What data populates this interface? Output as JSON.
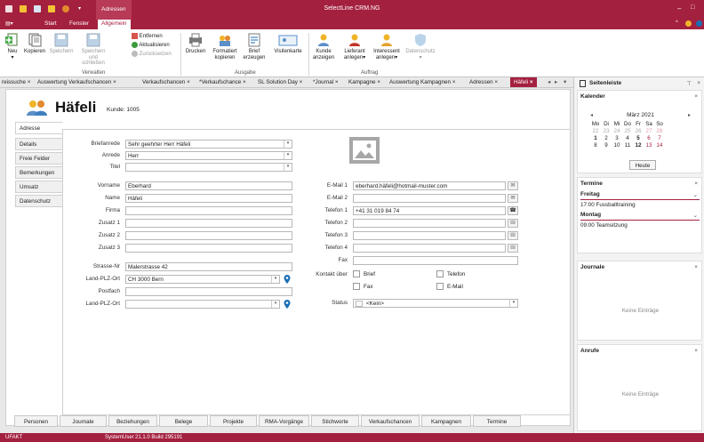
{
  "app": {
    "title": "SelectLine CRM.NG",
    "context_tab": "Adressen",
    "ribbon_tabs": [
      "Start",
      "Fenster",
      "Allgemein"
    ],
    "active_ribbon_tab": "Allgemein"
  },
  "ribbon": {
    "neu": "Neu",
    "kopieren": "Kopieren",
    "speichern": "Speichern",
    "speichern_schliessen_1": "Speichern und",
    "speichern_schliessen_2": "schließen",
    "entfernen": "Entfernen",
    "aktualisieren": "Aktualisieren",
    "zuruecksetzen": "Zurücksetzen",
    "drucken": "Drucken",
    "formatiert_1": "Formatiert",
    "formatiert_2": "kopieren",
    "brief_1": "Brief",
    "brief_2": "erzeugen",
    "visitenkarte": "Visitenkarte",
    "kunde_1": "Kunde",
    "kunde_2": "anzeigen",
    "lieferant_1": "Lieferant",
    "lieferant_2": "anlegen",
    "interessent_1": "Interessent",
    "interessent_2": "anlegen",
    "datenschutz": "Datenschutz",
    "group_verwalten": "Verwalten",
    "group_ausgabe": "Ausgabe",
    "group_auftrag": "Auftrag"
  },
  "doc_tabs": [
    "reissuche",
    "Auswertung Verkaufschancen",
    "Verkaufschancen",
    "*Verkaufschance",
    "SL Solution Day",
    "*Journal",
    "Kampagne",
    "Auswertung Kampagnen",
    "Adressen",
    "Häfeli"
  ],
  "header": {
    "name": "Häfeli",
    "kunde_label": "Kunde: 1005"
  },
  "side_tabs": [
    "Adresse",
    "Details",
    "Freie Felder",
    "Bemerkungen",
    "Umsatz",
    "Datenschutz"
  ],
  "form": {
    "briefanrede_label": "Briefanrede",
    "briefanrede": "Sehr geehrter Herr Häfeli",
    "anrede_label": "Anrede",
    "anrede": "Herr",
    "titel_label": "Titel",
    "titel": "",
    "vorname_label": "Vorname",
    "vorname": "Eberhard",
    "name_label": "Name",
    "name": "Häfeli",
    "firma_label": "Firma",
    "firma": "",
    "zusatz1_label": "Zusatz 1",
    "zusatz2_label": "Zusatz 2",
    "zusatz3_label": "Zusatz 3",
    "strasse_label": "Strasse-Nr",
    "strasse": "Malerstrasse 42",
    "landplz_label": "Land-PLZ-Ort",
    "landplz": "CH 3000 Bern",
    "postfach_label": "Postfach",
    "landplz2_label": "Land-PLZ-Ort",
    "email1_label": "E-Mail 1",
    "email1": "eberhard.häfeli@hotmail-muster.com",
    "email2_label": "E-Mail 2",
    "telefon1_label": "Telefon 1",
    "telefon1": "+41 31 019 84 74",
    "telefon2_label": "Telefon 2",
    "telefon3_label": "Telefon 3",
    "telefon4_label": "Telefon 4",
    "fax_label": "Fax",
    "kontakt_label": "Kontakt über",
    "brief_cb": "Brief",
    "telefon_cb": "Telefon",
    "fax_cb": "Fax",
    "email_cb": "E-Mail",
    "status_label": "Status",
    "status": "<Kein>"
  },
  "bottom_tabs": [
    "Personen",
    "Journale",
    "Beziehungen",
    "Belege",
    "Projekte",
    "RMA-Vorgänge",
    "Stichworte",
    "Verkaufschancen",
    "Kampagnen",
    "Termine"
  ],
  "sidebar": {
    "title": "Seitenleiste",
    "kalender": "Kalender",
    "month": "März 2021",
    "weekdays": [
      "Mo",
      "Di",
      "Mi",
      "Do",
      "Fr",
      "Sa",
      "So"
    ],
    "week1": [
      "22",
      "23",
      "24",
      "25",
      "26",
      "27",
      "28"
    ],
    "week2": [
      "1",
      "2",
      "3",
      "4",
      "5",
      "6",
      "7"
    ],
    "week3": [
      "8",
      "9",
      "10",
      "11",
      "12",
      "13",
      "14"
    ],
    "heute": "Heute",
    "termine": "Termine",
    "freitag": "Freitag",
    "termin1": "17:00 Fussballtraining",
    "montag": "Montag",
    "termin2": "09:00 Teamsitzung",
    "journale": "Journale",
    "journale_empty": "Keine Einträge",
    "anrufe": "Anrufe",
    "anrufe_empty": "Keine Einträge"
  },
  "status": {
    "left": "UFAKT",
    "user": "SystemUser",
    "build": "21.1.0 Build 295191"
  },
  "colors": {
    "accent": "#a4203f",
    "link_blue": "#1a6fb5"
  }
}
